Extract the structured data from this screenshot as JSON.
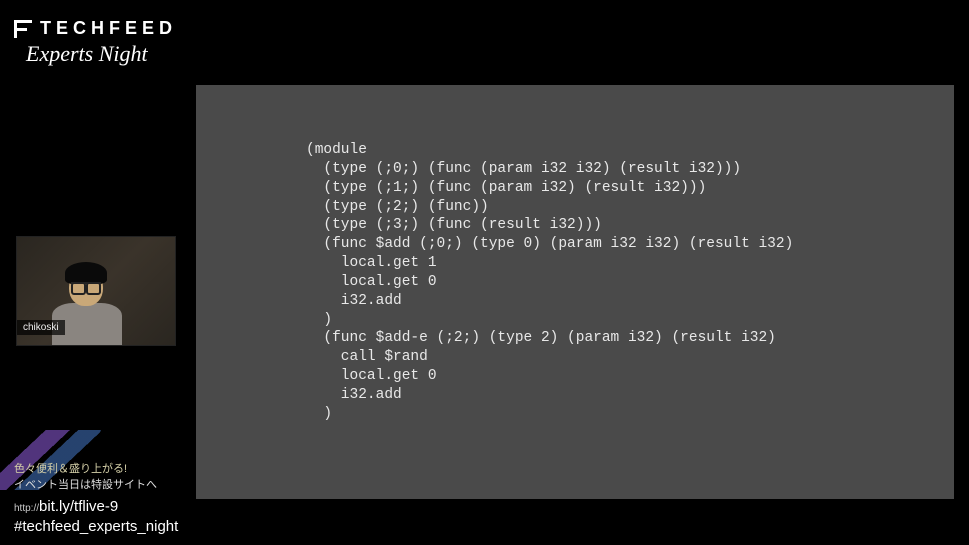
{
  "logo": {
    "main": "TECHFEED",
    "sub": "Experts Night"
  },
  "webcam": {
    "label": "chikoski"
  },
  "code": "(module\n  (type (;0;) (func (param i32 i32) (result i32)))\n  (type (;1;) (func (param i32) (result i32)))\n  (type (;2;) (func))\n  (type (;3;) (func (result i32)))\n  (func $add (;0;) (type 0) (param i32 i32) (result i32)\n    local.get 1\n    local.get 0\n    i32.add\n  )\n  (func $add-e (;2;) (type 2) (param i32) (result i32)\n    call $rand\n    local.get 0\n    i32.add\n  )",
  "bottom": {
    "promo1": "色々便利＆盛り上がる!",
    "promo2": "イベント当日は特設サイトへ",
    "url_prefix": "http://",
    "url": "bit.ly/tflive-9",
    "hashtag": "#techfeed_experts_night"
  }
}
